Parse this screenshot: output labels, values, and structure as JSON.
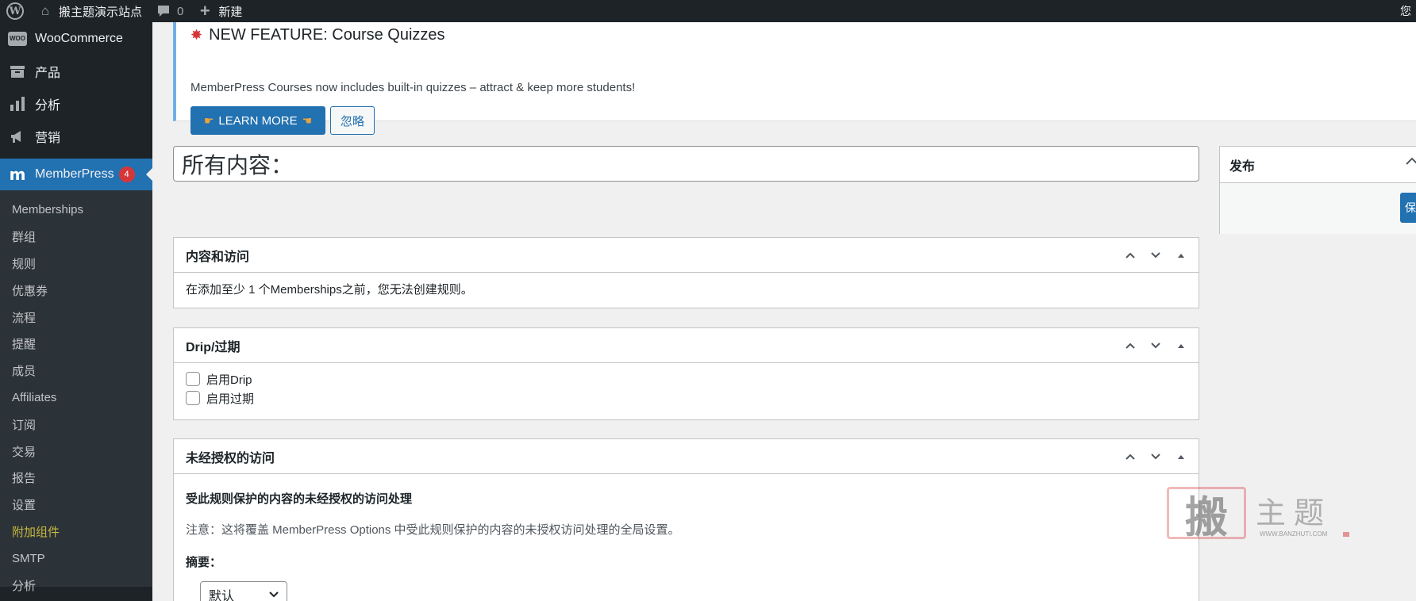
{
  "adminbar": {
    "site_name": "搬主题演示站点",
    "comment_count": "0",
    "new_label": "新建",
    "right_text": "您"
  },
  "sidebar": {
    "top_items": [
      {
        "label": "WooCommerce",
        "icon": "woo-icon"
      },
      {
        "label": "产品",
        "icon": "product-icon"
      },
      {
        "label": "分析",
        "icon": "analytics-icon"
      },
      {
        "label": "营销",
        "icon": "megaphone-icon"
      }
    ],
    "current": {
      "label": "MemberPress",
      "badge": "4",
      "icon": "memberpress-icon"
    },
    "submenu": [
      "Memberships",
      "群组",
      "规则",
      "优惠券",
      "流程",
      "提醒",
      "成员",
      "Affiliates",
      "订阅",
      "交易",
      "报告",
      "设置",
      "附加组件",
      "SMTP",
      "分析"
    ],
    "highlight_index": 12
  },
  "notice": {
    "title": "NEW FEATURE: Course Quizzes",
    "description": "MemberPress Courses now includes built-in quizzes – attract & keep more students!",
    "learn_more": "LEARN MORE",
    "dismiss": "忽略"
  },
  "title_input": {
    "value": "所有内容："
  },
  "boxes": {
    "content_access": {
      "title": "内容和访问",
      "message": "在添加至少 1 个Memberships之前，您无法创建规则。"
    },
    "drip": {
      "title": "Drip/过期",
      "enable_drip": "启用Drip",
      "enable_expiration": "启用过期"
    },
    "unauthorized": {
      "title": "未经授权的访问",
      "subheading": "受此规则保护的内容的未经授权的访问处理",
      "note": "注意：这将覆盖 MemberPress Options 中受此规则保护的内容的未授权访问处理的全局设置。",
      "excerpt_label": "摘要：",
      "excerpt_value": "默认"
    }
  },
  "publish": {
    "title": "发布",
    "button_label": "保存"
  },
  "watermark": {
    "logo_char": "搬",
    "text": "主题",
    "url": "WWW.BANZHUTI.COM"
  },
  "colors": {
    "adminbar_bg": "#1d2327",
    "sidebar_bg": "#1d2327",
    "accent": "#2271b1",
    "badge": "#d63638",
    "highlight": "#c6b73f"
  }
}
